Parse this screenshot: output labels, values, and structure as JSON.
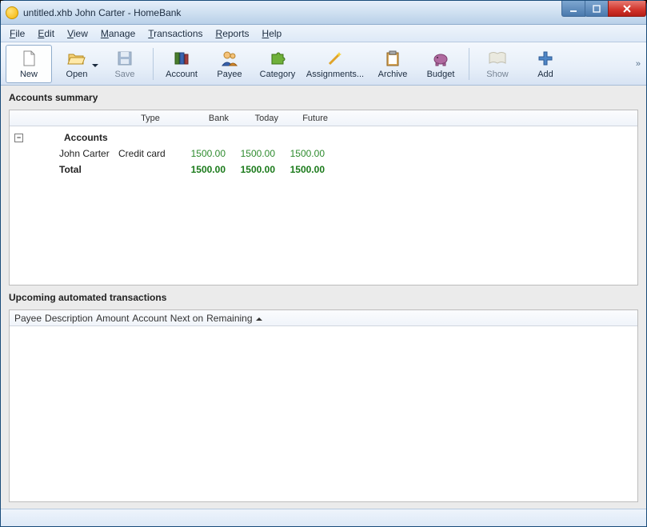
{
  "window": {
    "title": "untitled.xhb John Carter - HomeBank"
  },
  "menu": {
    "file": "File",
    "edit": "Edit",
    "view": "View",
    "manage": "Manage",
    "transactions": "Transactions",
    "reports": "Reports",
    "help": "Help"
  },
  "toolbar": {
    "new": "New",
    "open": "Open",
    "save": "Save",
    "account": "Account",
    "payee": "Payee",
    "category": "Category",
    "assignments": "Assignments...",
    "archive": "Archive",
    "budget": "Budget",
    "show": "Show",
    "add": "Add"
  },
  "sections": {
    "accounts_summary": "Accounts summary",
    "upcoming": "Upcoming automated transactions"
  },
  "accounts_grid": {
    "headers": {
      "type": "Type",
      "bank": "Bank",
      "today": "Today",
      "future": "Future"
    },
    "group_label": "Accounts",
    "rows": [
      {
        "name": "John Carter",
        "type": "Credit card",
        "bank": "1500.00",
        "today": "1500.00",
        "future": "1500.00"
      }
    ],
    "total_label": "Total",
    "totals": {
      "bank": "1500.00",
      "today": "1500.00",
      "future": "1500.00"
    }
  },
  "upcoming_grid": {
    "headers": {
      "payee": "Payee",
      "description": "Description",
      "amount": "Amount",
      "account": "Account",
      "next_on": "Next on",
      "remaining": "Remaining"
    }
  }
}
